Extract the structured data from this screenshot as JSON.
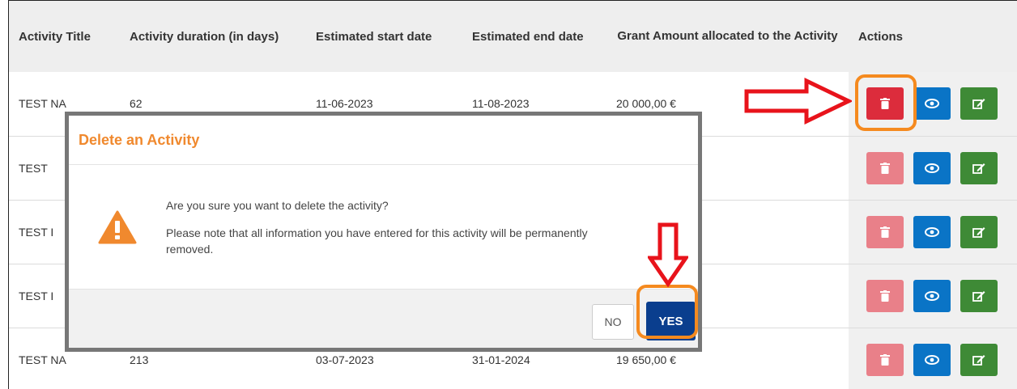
{
  "table": {
    "headers": [
      "Activity Title",
      "Activity duration (in days)",
      "Estimated start date",
      "Estimated end date",
      "Grant Amount allocated to the Activity",
      "Actions"
    ],
    "rows": [
      {
        "title": "TEST NA",
        "duration": "62",
        "start": "11-06-2023",
        "end": "11-08-2023",
        "amount": "20 000,00 €"
      },
      {
        "title": "TEST",
        "duration": "",
        "start": "",
        "end": "",
        "amount": ""
      },
      {
        "title": "TEST I",
        "duration": "",
        "start": "",
        "end": "",
        "amount": ""
      },
      {
        "title": "TEST I",
        "duration": "",
        "start": "",
        "end": "",
        "amount": ""
      },
      {
        "title": "TEST NA",
        "duration": "213",
        "start": "03-07-2023",
        "end": "31-01-2024",
        "amount": "19 650,00 €"
      }
    ],
    "action_icons": [
      "trash-icon",
      "eye-icon",
      "edit-icon"
    ]
  },
  "modal": {
    "title": "Delete an Activity",
    "question": "Are you sure you want to delete the activity?",
    "note": "Please note that all information you have entered for this activity will be permanently removed.",
    "no_label": "NO",
    "yes_label": "YES",
    "icon": "warning-icon"
  },
  "colors": {
    "accent_orange": "#f58a1f",
    "annotation_red": "#e8131b",
    "delete_red": "#dc2c3c",
    "view_blue": "#0a74c6",
    "edit_green": "#3e8a36",
    "yes_blue": "#0a3e8e",
    "title_orange": "#f0892e"
  }
}
